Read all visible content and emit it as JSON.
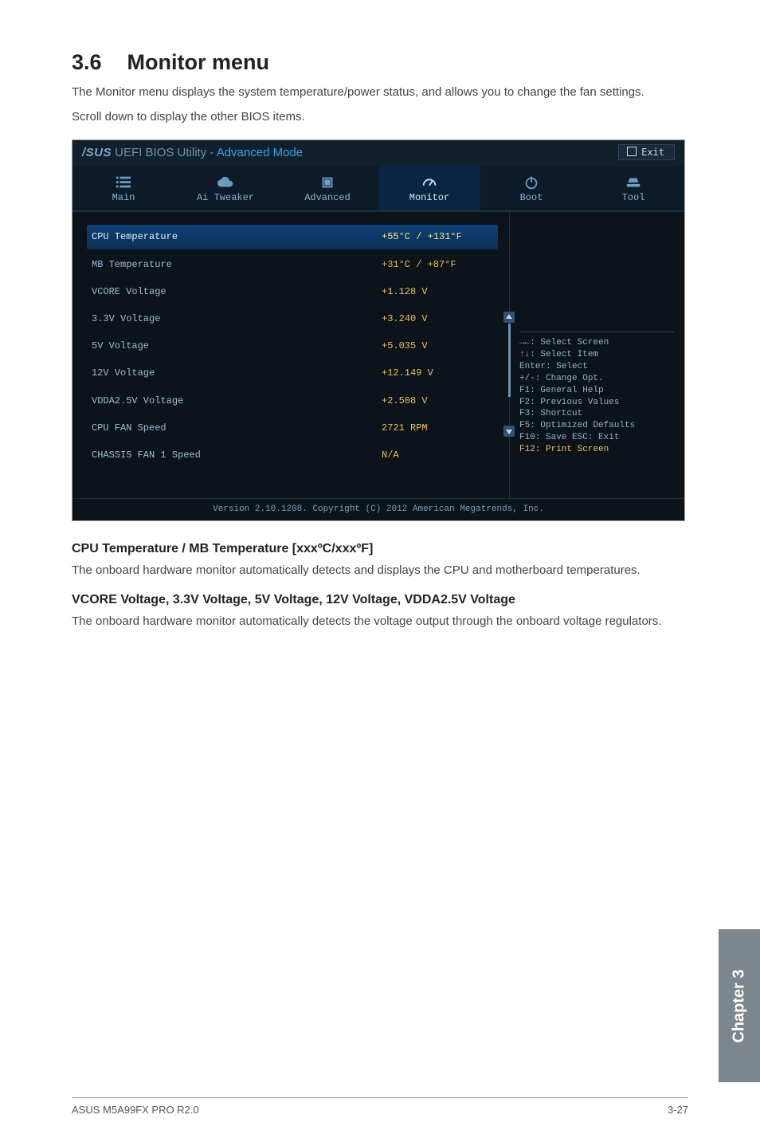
{
  "section": {
    "number": "3.6",
    "title": "Monitor menu"
  },
  "intro": {
    "p1": "The Monitor menu displays the system temperature/power status, and allows you to change the fan settings.",
    "p2": "Scroll down to display the other BIOS items."
  },
  "bios": {
    "brand": "/SUS",
    "title_rest": " UEFI BIOS Utility - ",
    "title_mode": "Advanced Mode",
    "exit": "Exit",
    "tabs": {
      "main": "Main",
      "ai": "Ai Tweaker",
      "advanced": "Advanced",
      "monitor": "Monitor",
      "boot": "Boot",
      "tool": "Tool"
    },
    "rows": [
      {
        "label": "CPU Temperature",
        "value": "+55°C / +131°F",
        "selected": true
      },
      {
        "label": "MB Temperature",
        "value": "+31°C / +87°F"
      },
      {
        "label": "VCORE Voltage",
        "value": "+1.128 V"
      },
      {
        "label": "3.3V Voltage",
        "value": "+3.240 V"
      },
      {
        "label": "5V Voltage",
        "value": "+5.035 V"
      },
      {
        "label": "12V Voltage",
        "value": "+12.149 V"
      },
      {
        "label": "VDDA2.5V Voltage",
        "value": "+2.508 V"
      },
      {
        "label": "CPU FAN Speed",
        "value": "2721 RPM"
      },
      {
        "label": "CHASSIS FAN 1 Speed",
        "value": "N/A"
      }
    ],
    "help": [
      "→←: Select Screen",
      "↑↓: Select Item",
      "Enter: Select",
      "+/-: Change Opt.",
      "F1: General Help",
      "F2: Previous Values",
      "F3: Shortcut",
      "F5: Optimized Defaults",
      "F10: Save  ESC: Exit",
      "F12: Print Screen"
    ],
    "footer": "Version 2.10.1208. Copyright (C) 2012 American Megatrends, Inc."
  },
  "sub1": {
    "heading": "CPU Temperature / MB Temperature [xxxºC/xxxºF]",
    "body": "The onboard hardware monitor automatically detects and displays the CPU and motherboard temperatures."
  },
  "sub2": {
    "heading": "VCORE Voltage, 3.3V Voltage, 5V Voltage, 12V Voltage, VDDA2.5V Voltage",
    "body": "The onboard hardware monitor automatically detects the voltage output through the onboard voltage regulators."
  },
  "side_tab": "Chapter 3",
  "footer": {
    "left": "ASUS M5A99FX PRO R2.0",
    "right": "3-27"
  }
}
